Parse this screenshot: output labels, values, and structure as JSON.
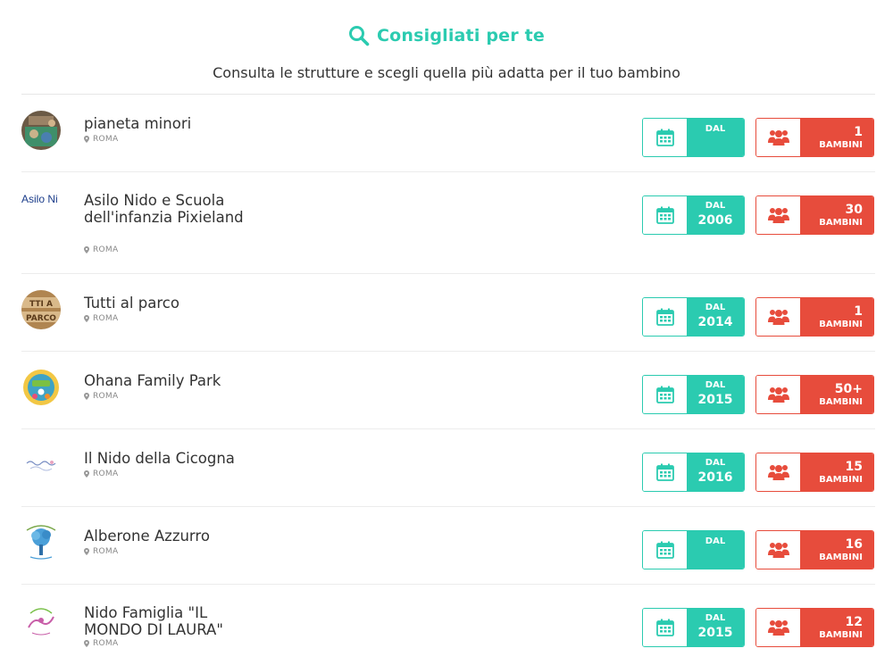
{
  "header": {
    "title": "Consigliati per te",
    "subtitle": "Consulta le strutture e scegli quella più adatta per il tuo bambino",
    "icon": "search-icon"
  },
  "colors": {
    "accent": "#2bcbb0",
    "danger": "#e74c3c"
  },
  "labels": {
    "since": "DAL",
    "kids": "BAMBINI"
  },
  "listings": [
    {
      "name": "pianeta minori",
      "city": "ROMA",
      "since": "",
      "kids": "1",
      "logo_text": ""
    },
    {
      "name": "Asilo Nido e Scuola dell'infanzia Pixieland",
      "city": "ROMA",
      "since": "2006",
      "kids": "30",
      "logo_text": "Asilo Ni"
    },
    {
      "name": "Tutti al parco",
      "city": "ROMA",
      "since": "2014",
      "kids": "1",
      "logo_text": "PARCO"
    },
    {
      "name": "Ohana Family Park",
      "city": "ROMA",
      "since": "2015",
      "kids": "50+",
      "logo_text": ""
    },
    {
      "name": "Il Nido della Cicogna",
      "city": "ROMA",
      "since": "2016",
      "kids": "15",
      "logo_text": ""
    },
    {
      "name": "Alberone Azzurro",
      "city": "ROMA",
      "since": "",
      "kids": "16",
      "logo_text": ""
    },
    {
      "name": "Nido Famiglia \"IL MONDO DI LAURA\"",
      "city": "ROMA",
      "since": "2015",
      "kids": "12",
      "logo_text": ""
    }
  ]
}
